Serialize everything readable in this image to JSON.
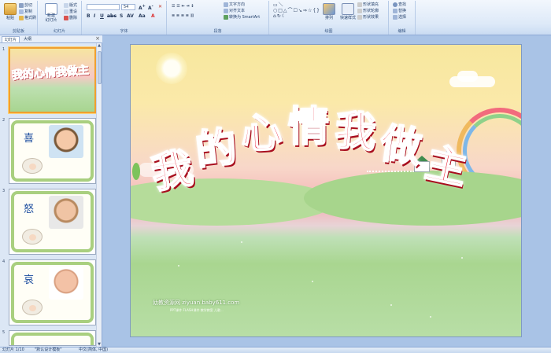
{
  "ribbon": {
    "clipboard": {
      "label": "剪贴板",
      "paste": "粘贴",
      "cut": "剪切",
      "copy": "复制",
      "format_painter": "格式刷"
    },
    "slides": {
      "label": "幻灯片",
      "new_slide": "新建\n幻灯片",
      "layout": "版式",
      "reset": "重设",
      "delete": "删除"
    },
    "font": {
      "label": "字体",
      "font_name": "",
      "font_size": "54"
    },
    "paragraph": {
      "label": "段落",
      "text_direction": "文字方向",
      "align_text": "对齐文本",
      "smartart": "转换为 SmartArt"
    },
    "drawing": {
      "label": "绘图",
      "arrange": "排列",
      "quick_styles": "快速样式",
      "shape_fill": "形状填充",
      "shape_outline": "形状轮廓",
      "shape_effects": "形状效果"
    },
    "editing": {
      "label": "编辑",
      "find": "查找",
      "replace": "替换",
      "select": "选择"
    }
  },
  "panel": {
    "tab_slides": "幻灯片",
    "tab_outline": "大纲",
    "close": "×",
    "thumbs": [
      {
        "num": "1",
        "text": "我的心情我做主"
      },
      {
        "num": "2",
        "text": "喜"
      },
      {
        "num": "3",
        "text": "怒"
      },
      {
        "num": "4",
        "text": "哀"
      },
      {
        "num": "5",
        "text": ""
      }
    ]
  },
  "slide": {
    "title_chars": [
      "我",
      "的",
      "心",
      "情",
      "我",
      "做",
      "主"
    ],
    "watermark": "幼教资源网 ziyuan.baby611.com",
    "watermark_sub": "PPT课件 FLASH课件 教学教案 儿歌..."
  },
  "statusbar": {
    "slide_pos": "幻灯片 1/10",
    "theme": "\"默认设计模板\"",
    "language": "中文(简体, 中国)"
  },
  "colors": {
    "title_red": "#e8152b",
    "ribbon_bg": "#dde9f8",
    "selected_thumb": "#f0a030"
  }
}
